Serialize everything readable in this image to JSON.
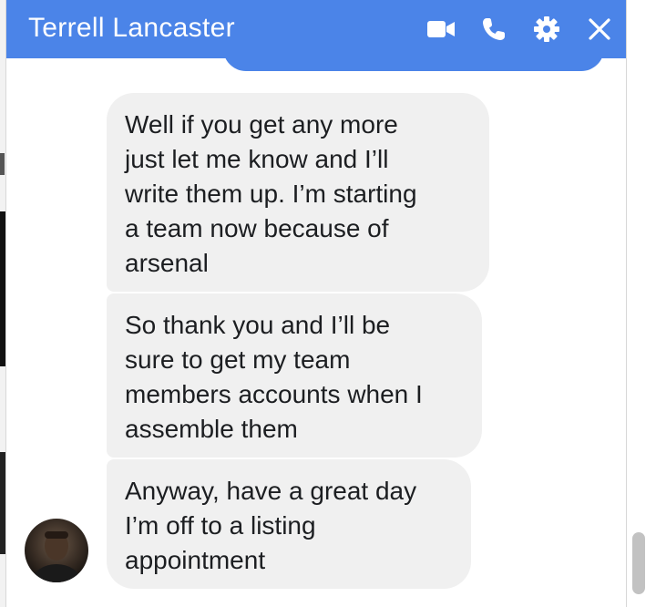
{
  "header": {
    "title": "Terrell Lancaster",
    "background_color": "#4b84e8",
    "icons": [
      "video-call-icon",
      "phone-call-icon",
      "settings-gear-icon",
      "close-icon"
    ]
  },
  "messages": [
    {
      "direction": "received",
      "text": "Well if you get any more\njust let me know and I’ll\nwrite them up.  I’m starting\na team now because of\narsenal"
    },
    {
      "direction": "received",
      "text": "So thank you and I’ll be\nsure to get my team\nmembers accounts when I\nassemble them"
    },
    {
      "direction": "received",
      "text": "Anyway, have a great day\nI’m off to a listing\nappointment"
    }
  ],
  "colors": {
    "sent_bubble": "#4b84e8",
    "received_bubble": "#f0f0f0",
    "text": "#1c1e21"
  }
}
